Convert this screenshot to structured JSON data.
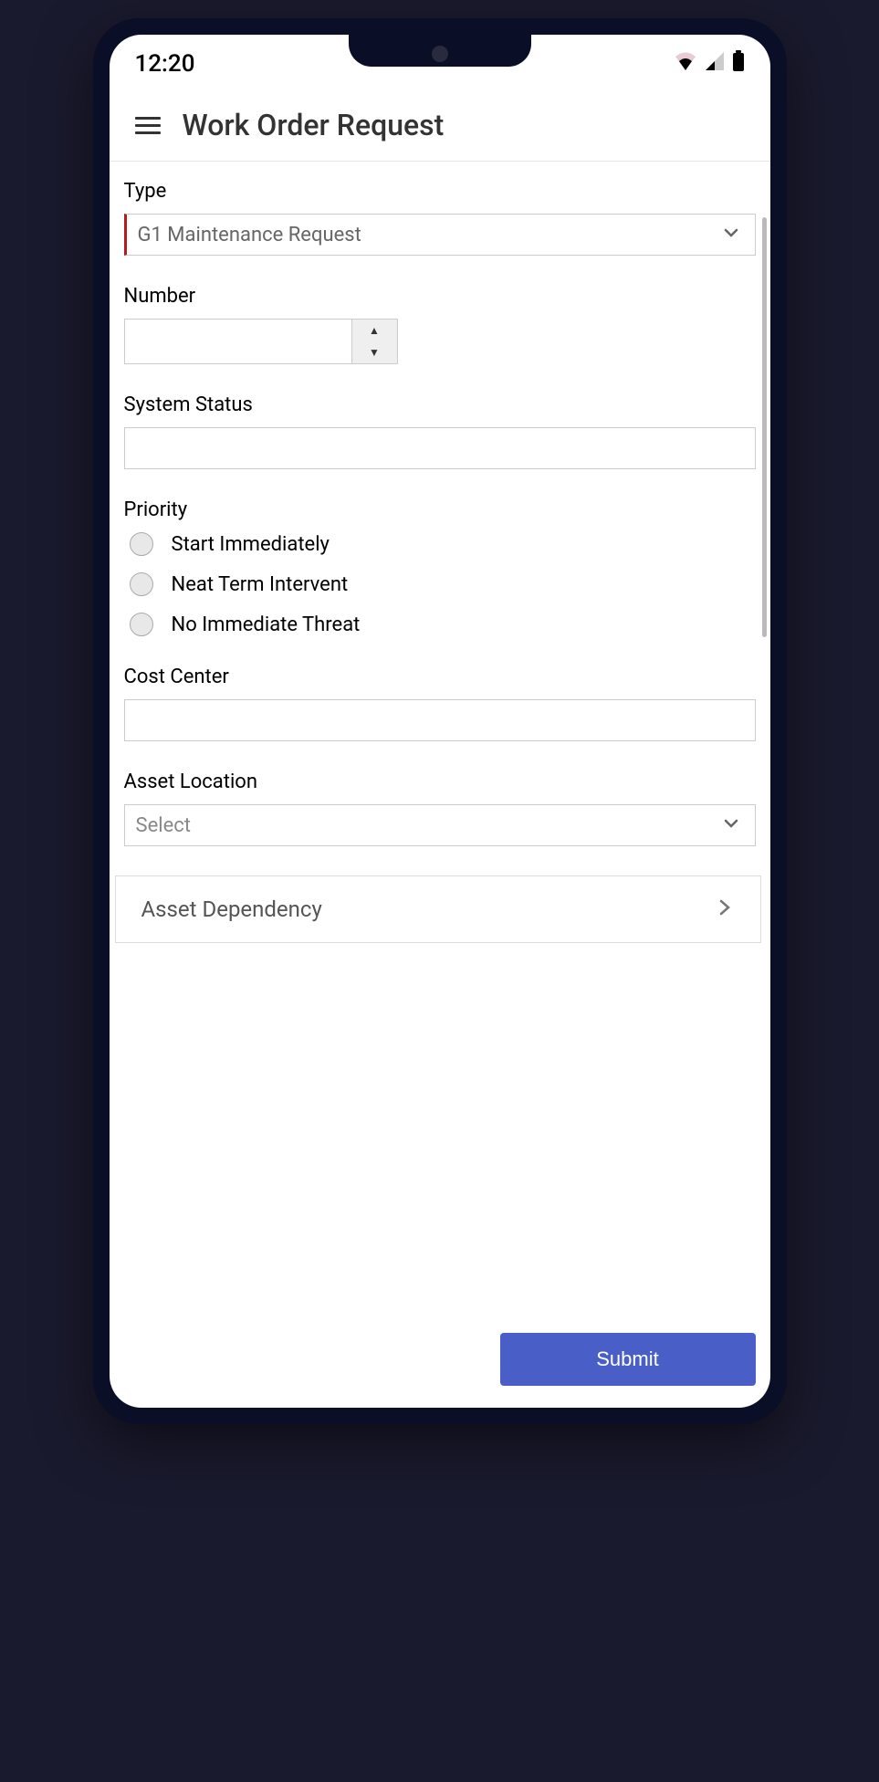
{
  "status_bar": {
    "time": "12:20"
  },
  "header": {
    "title": "Work Order Request"
  },
  "form": {
    "type": {
      "label": "Type",
      "value": "G1 Maintenance Request"
    },
    "number": {
      "label": "Number",
      "value": ""
    },
    "system_status": {
      "label": "System Status",
      "value": ""
    },
    "priority": {
      "label": "Priority",
      "options": [
        "Start Immediately",
        "Neat Term Intervent",
        "No Immediate Threat"
      ]
    },
    "cost_center": {
      "label": "Cost Center",
      "value": ""
    },
    "asset_location": {
      "label": "Asset Location",
      "placeholder": "Select"
    },
    "asset_dependency": {
      "label": "Asset Dependency"
    }
  },
  "footer": {
    "submit_label": "Submit"
  }
}
